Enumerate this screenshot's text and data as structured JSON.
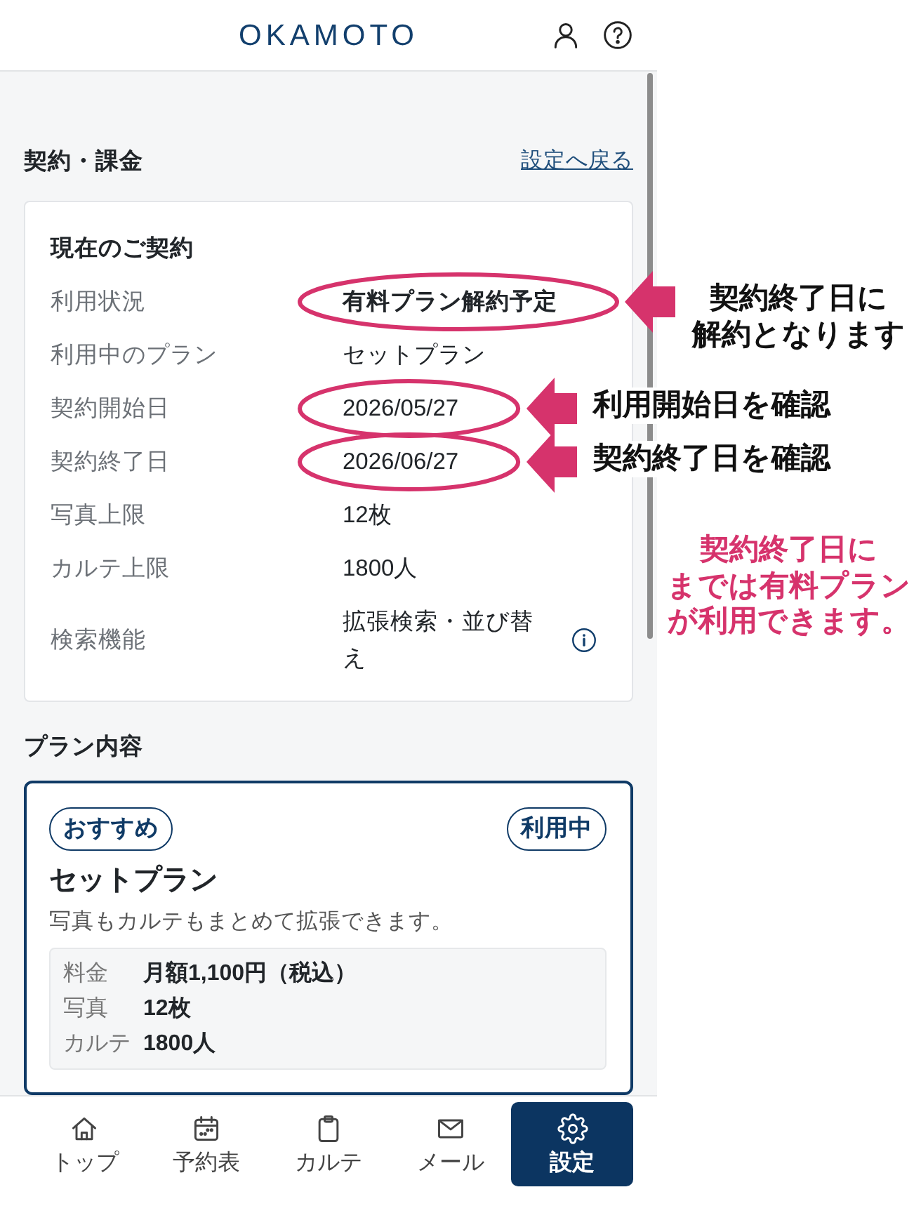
{
  "header": {
    "logo": "OKAMOTO"
  },
  "page": {
    "title": "契約・課金",
    "back_link": "設定へ戻る"
  },
  "contract": {
    "title": "現在のご契約",
    "rows": [
      {
        "label": "利用状況",
        "value": "有料プラン解約予定",
        "bold": true,
        "info": false,
        "circled": true,
        "callout": [
          "契約終了日に",
          "解約となります"
        ]
      },
      {
        "label": "利用中のプラン",
        "value": "セットプラン",
        "bold": false,
        "info": false,
        "circled": false
      },
      {
        "label": "契約開始日",
        "value": "2026/05/27",
        "bold": false,
        "info": false,
        "circled": true,
        "callout": [
          "利用開始日を確認"
        ]
      },
      {
        "label": "契約終了日",
        "value": "2026/06/27",
        "bold": false,
        "info": false,
        "circled": true,
        "callout": [
          "契約終了日を確認"
        ]
      },
      {
        "label": "写真上限",
        "value": "12枚",
        "bold": false,
        "info": false,
        "circled": false
      },
      {
        "label": "カルテ上限",
        "value": "1800人",
        "bold": false,
        "info": false,
        "circled": false
      },
      {
        "label": "検索機能",
        "value": "拡張検索・並び替え",
        "bold": false,
        "info": true,
        "circled": false
      }
    ]
  },
  "plan_section": {
    "title": "プラン内容",
    "plan": {
      "tags": [
        "おすすめ",
        "利用中"
      ],
      "name": "セットプラン",
      "description": "写真もカルテもまとめて拡張できます。",
      "details": [
        {
          "label": "料金",
          "value": "月額1,100円（税込）"
        },
        {
          "label": "写真",
          "value": "12枚"
        },
        {
          "label": "カルテ",
          "value": "1800人"
        }
      ]
    }
  },
  "bottom_nav": [
    {
      "label": "トップ",
      "kind": "home",
      "selected": false
    },
    {
      "label": "予約表",
      "kind": "calendar",
      "selected": false
    },
    {
      "label": "カルテ",
      "kind": "clipboard",
      "selected": false
    },
    {
      "label": "メール",
      "kind": "mail",
      "selected": false
    },
    {
      "label": "設定",
      "kind": "settings",
      "selected": true
    }
  ],
  "note": [
    "契約終了日に",
    "までは有料プラン",
    "が利用できます。"
  ]
}
